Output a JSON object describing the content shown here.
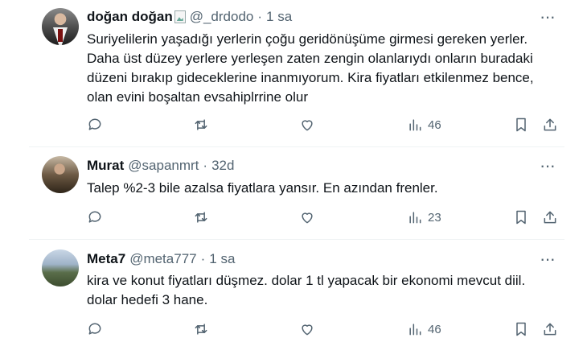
{
  "tweets": [
    {
      "name": "doğan doğan",
      "handle": "@_drdodo",
      "separator": "·",
      "time": "1 sa",
      "lines": [
        "Suriyelilerin yaşadığı yerlerin çoğu geridönüşüme girmesi gereken yerler.",
        "Daha üst düzey yerlere yerleşen zaten zengin olanlarıydı onların buradaki",
        "düzeni bırakıp gideceklerine inanmıyorum. Kira fiyatları etkilenmez bence,",
        "olan evini boşaltan evsahiplrrine olur"
      ],
      "views": "46"
    },
    {
      "name": "Murat",
      "handle": "@sapanmrt",
      "separator": "·",
      "time": "32d",
      "lines": [
        "Talep %2-3 bile azalsa fiyatlara yansır. En azından frenler."
      ],
      "views": "23"
    },
    {
      "name": "Meta7",
      "handle": "@meta777",
      "separator": "·",
      "time": "1 sa",
      "lines": [
        "kira ve konut fiyatları düşmez. dolar 1 tl yapacak bir ekonomi mevcut diil.",
        "dolar hedefi 3 hane."
      ],
      "views": "46"
    }
  ],
  "more_label": "···",
  "icons": [
    "reply-icon",
    "retweet-icon",
    "like-icon",
    "views-icon",
    "bookmark-icon",
    "share-icon"
  ]
}
